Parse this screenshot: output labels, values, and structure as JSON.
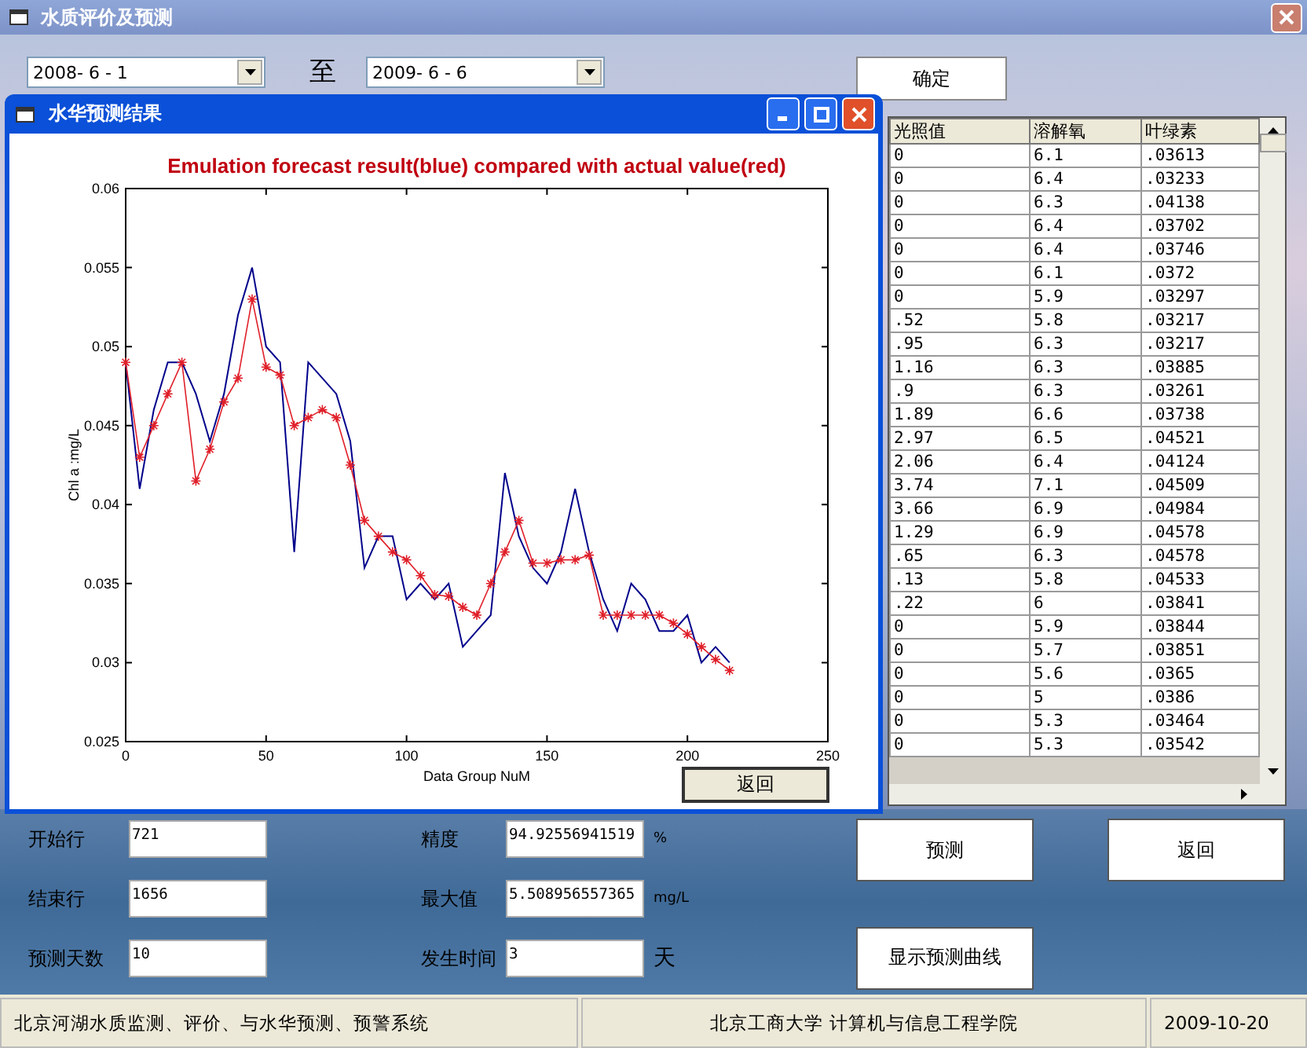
{
  "window": {
    "title": "水质评价及预测"
  },
  "date_range": {
    "start": "2008- 6 - 1",
    "separator": "至",
    "end": "2009- 6 - 6"
  },
  "confirm_button": "确定",
  "table": {
    "columns": [
      "光照值",
      "溶解氧",
      "叶绿素"
    ],
    "rows": [
      [
        "0",
        "6.1",
        ".03613"
      ],
      [
        "0",
        "6.4",
        ".03233"
      ],
      [
        "0",
        "6.3",
        ".04138"
      ],
      [
        "0",
        "6.4",
        ".03702"
      ],
      [
        "0",
        "6.4",
        ".03746"
      ],
      [
        "0",
        "6.1",
        ".0372"
      ],
      [
        "0",
        "5.9",
        ".03297"
      ],
      [
        ".52",
        "5.8",
        ".03217"
      ],
      [
        ".95",
        "6.3",
        ".03217"
      ],
      [
        "1.16",
        "6.3",
        ".03885"
      ],
      [
        ".9",
        "6.3",
        ".03261"
      ],
      [
        "1.89",
        "6.6",
        ".03738"
      ],
      [
        "2.97",
        "6.5",
        ".04521"
      ],
      [
        "2.06",
        "6.4",
        ".04124"
      ],
      [
        "3.74",
        "7.1",
        ".04509"
      ],
      [
        "3.66",
        "6.9",
        ".04984"
      ],
      [
        "1.29",
        "6.9",
        ".04578"
      ],
      [
        ".65",
        "6.3",
        ".04578"
      ],
      [
        ".13",
        "5.8",
        ".04533"
      ],
      [
        ".22",
        "6",
        ".03841"
      ],
      [
        "0",
        "5.9",
        ".03844"
      ],
      [
        "0",
        "5.7",
        ".03851"
      ],
      [
        "0",
        "5.6",
        ".0365"
      ],
      [
        "0",
        "5",
        ".0386"
      ],
      [
        "0",
        "5.3",
        ".03464"
      ],
      [
        "0",
        "5.3",
        ".03542"
      ]
    ]
  },
  "dialog": {
    "title": "水华预测结果",
    "back_button": "返回",
    "chart_data": {
      "type": "line",
      "title": "Emulation forecast result(blue) compared with actual value(red)",
      "xlabel": "Data Group NuM",
      "ylabel": "Chl a  :mg/L",
      "x": [
        0,
        5,
        10,
        15,
        20,
        25,
        30,
        35,
        40,
        45,
        50,
        55,
        60,
        65,
        70,
        75,
        80,
        85,
        90,
        95,
        100,
        105,
        110,
        115,
        120,
        125,
        130,
        135,
        140,
        145,
        150,
        155,
        160,
        165,
        170,
        175,
        180,
        185,
        190,
        195,
        200,
        205,
        210,
        215
      ],
      "series": [
        {
          "color": "#00008b",
          "values": [
            0.049,
            0.041,
            0.046,
            0.049,
            0.049,
            0.047,
            0.044,
            0.047,
            0.052,
            0.055,
            0.05,
            0.049,
            0.037,
            0.049,
            0.048,
            0.047,
            0.044,
            0.036,
            0.038,
            0.038,
            0.034,
            0.035,
            0.034,
            0.035,
            0.031,
            0.032,
            0.033,
            0.042,
            0.038,
            0.036,
            0.035,
            0.037,
            0.041,
            0.037,
            0.034,
            0.032,
            0.035,
            0.034,
            0.032,
            0.032,
            0.033,
            0.03,
            0.031,
            0.03
          ]
        },
        {
          "color": "#e0202a",
          "marker": "cross",
          "values": [
            0.049,
            0.043,
            0.045,
            0.047,
            0.049,
            0.0415,
            0.0435,
            0.0465,
            0.048,
            0.053,
            0.0487,
            0.0482,
            0.045,
            0.0455,
            0.046,
            0.0455,
            0.0425,
            0.039,
            0.038,
            0.037,
            0.0365,
            0.0355,
            0.0343,
            0.0342,
            0.0335,
            0.033,
            0.035,
            0.037,
            0.039,
            0.0363,
            0.0363,
            0.0365,
            0.0365,
            0.0368,
            0.033,
            0.033,
            0.033,
            0.033,
            0.033,
            0.0325,
            0.0318,
            0.031,
            0.0302,
            0.0295
          ]
        }
      ],
      "xlim": [
        0,
        250
      ],
      "ylim": [
        0.025,
        0.06
      ],
      "xticks": [
        0,
        50,
        100,
        150,
        200,
        250
      ],
      "yticks": [
        {
          "value": 0.025,
          "label": "0.025"
        },
        {
          "value": 0.03,
          "label": "0.03"
        },
        {
          "value": 0.035,
          "label": "0.035"
        },
        {
          "value": 0.04,
          "label": "0.04"
        },
        {
          "value": 0.045,
          "label": "0.045"
        },
        {
          "value": 0.05,
          "label": "0.05"
        },
        {
          "value": 0.055,
          "label": "0.055"
        },
        {
          "value": 0.06,
          "label": "0.06"
        }
      ]
    }
  },
  "form": {
    "left_fields": [
      {
        "label": "开始行",
        "value": "721"
      },
      {
        "label": "结束行",
        "value": "1656"
      },
      {
        "label": "预测天数",
        "value": "10"
      }
    ],
    "right_fields": [
      {
        "label": "精度",
        "value": "94.92556941519",
        "unit": "%"
      },
      {
        "label": "最大值",
        "value": "5.508956557365",
        "unit": "mg/L"
      },
      {
        "label": "发生时间",
        "value": "3",
        "unit": "天"
      }
    ],
    "buttons": [
      "预测",
      "返回",
      "显示预测曲线"
    ]
  },
  "status_bar": [
    "北京河湖水质监测、评价、与水华预测、预警系统",
    "北京工商大学 计算机与信息工程学院",
    "2009-10-20"
  ]
}
